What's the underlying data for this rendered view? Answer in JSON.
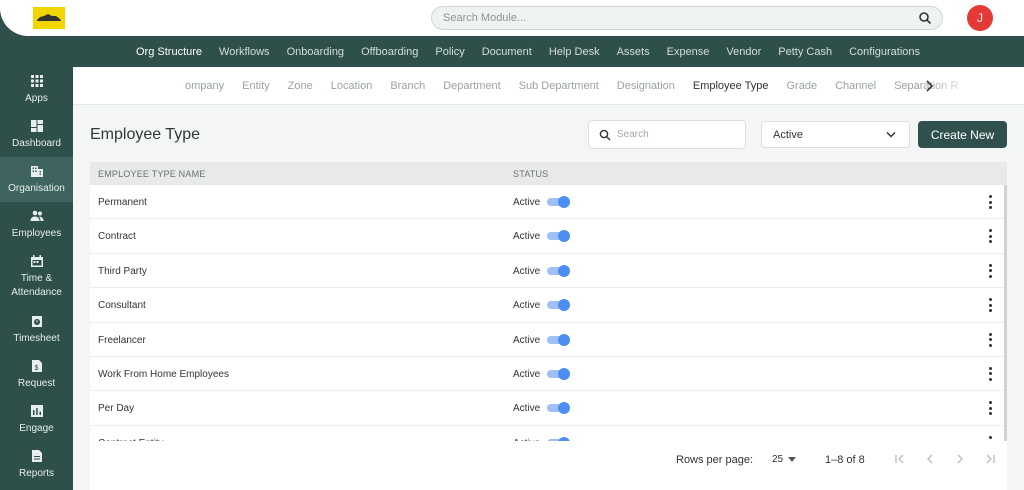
{
  "app": {
    "avatar_initial": "J",
    "search_placeholder": "Search Module...",
    "accent": "#2f504c",
    "avatar_color": "#e53935"
  },
  "main_nav": [
    "Org Structure",
    "Workflows",
    "Onboarding",
    "Offboarding",
    "Policy",
    "Document",
    "Help Desk",
    "Assets",
    "Expense",
    "Vendor",
    "Petty Cash",
    "Configurations"
  ],
  "sidebar": [
    {
      "label": "Apps",
      "icon": "apps-grid-icon"
    },
    {
      "label": "Dashboard",
      "icon": "dashboard-icon"
    },
    {
      "label": "Organisation",
      "icon": "building-icon"
    },
    {
      "label": "Employees",
      "icon": "people-icon"
    },
    {
      "label": "Time & Attendance",
      "icon": "calendar-icon"
    },
    {
      "label": "Timesheet",
      "icon": "timesheet-icon"
    },
    {
      "label": "Request",
      "icon": "request-icon"
    },
    {
      "label": "Engage",
      "icon": "chart-icon"
    },
    {
      "label": "Reports",
      "icon": "report-icon"
    }
  ],
  "sub_tabs": [
    "ompany",
    "Entity",
    "Zone",
    "Location",
    "Branch",
    "Department",
    "Sub Department",
    "Designation",
    "Employee Type",
    "Grade",
    "Channel",
    "Separation R"
  ],
  "page": {
    "title": "Employee Type",
    "search_placeholder": "Search",
    "status_filter": "Active",
    "create_button": "Create New"
  },
  "table": {
    "headers": [
      "EMPLOYEE TYPE NAME",
      "STATUS"
    ],
    "rows": [
      {
        "name": "Permanent",
        "status": "Active",
        "enabled": true
      },
      {
        "name": "Contract",
        "status": "Active",
        "enabled": true
      },
      {
        "name": "Third Party",
        "status": "Active",
        "enabled": true
      },
      {
        "name": "Consultant",
        "status": "Active",
        "enabled": true
      },
      {
        "name": "Freelancer",
        "status": "Active",
        "enabled": true
      },
      {
        "name": "Work From Home Employees",
        "status": "Active",
        "enabled": true
      },
      {
        "name": "Per Day",
        "status": "Active",
        "enabled": true
      },
      {
        "name": "Contract Entity",
        "status": "Active",
        "enabled": true
      }
    ]
  },
  "pagination": {
    "rows_per_page_label": "Rows per page:",
    "rows_per_page": "25",
    "range": "1–8 of 8"
  }
}
